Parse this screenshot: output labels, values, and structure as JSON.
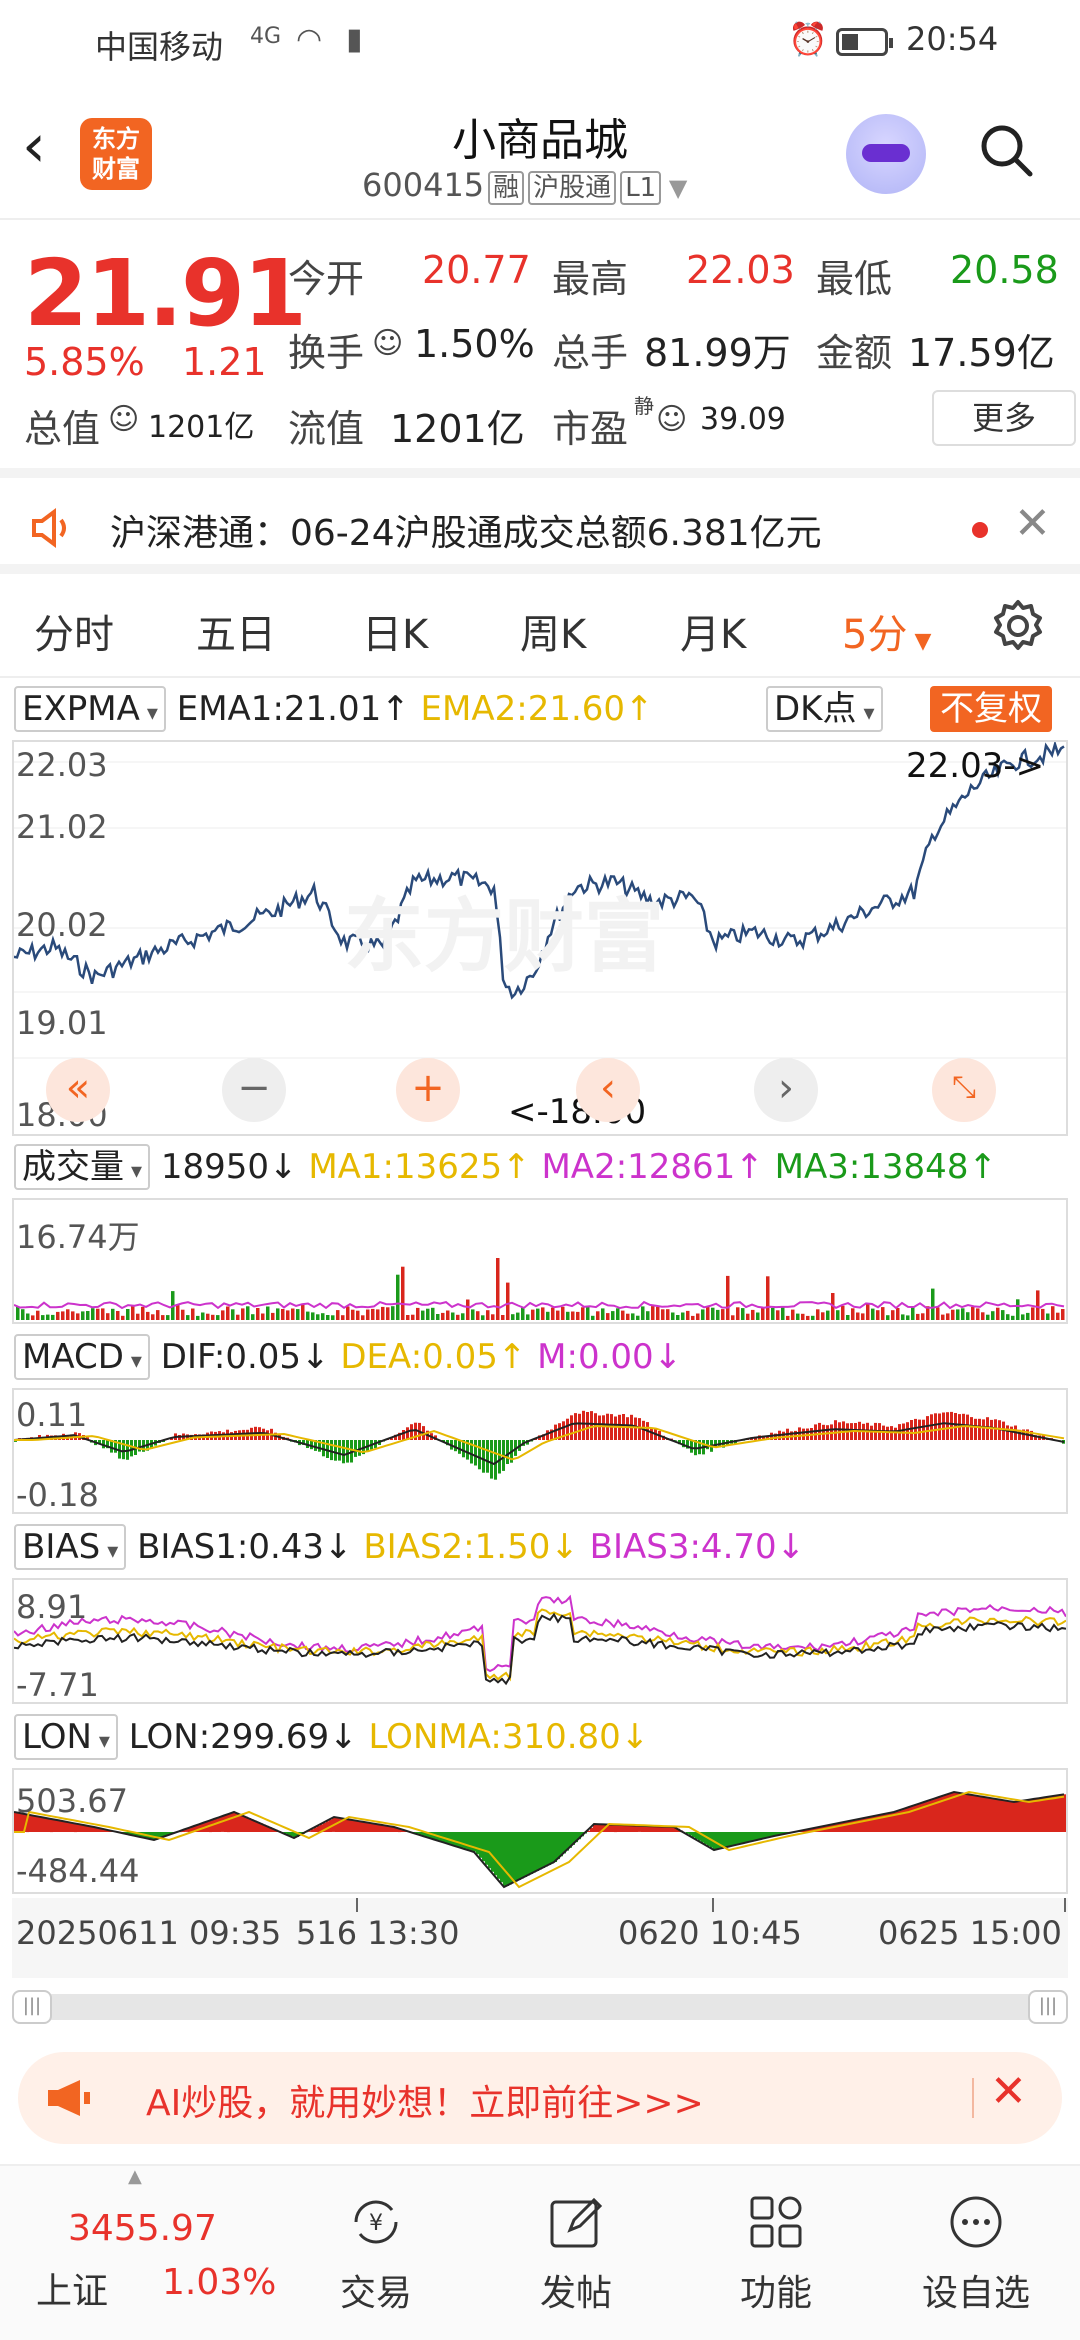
{
  "status_bar": {
    "carrier": "中国移动",
    "network": "4G",
    "time": "20:54"
  },
  "header": {
    "back_icon": "chevron-left-icon",
    "logo_text_1": "东方",
    "logo_text_2": "财富",
    "title": "小商品城",
    "code": "600415",
    "tag_margin": "融",
    "tag_connect": "沪股通",
    "tag_level": "L1"
  },
  "quote": {
    "price": "21.91",
    "change_pct": "5.85%",
    "change": "1.21",
    "open_label": "今开",
    "open": "20.77",
    "high_label": "最高",
    "high": "22.03",
    "low_label": "最低",
    "low": "20.58",
    "turnover_label": "换手",
    "turnover": "1.50%",
    "volume_label": "总手",
    "volume": "81.99万",
    "amount_label": "金额",
    "amount": "17.59亿",
    "mktcap_label": "总值",
    "mktcap": "1201亿",
    "float_label": "流值",
    "float": "1201亿",
    "pe_label": "市盈",
    "pe_sup": "静",
    "pe": "39.09",
    "more_button": "更多"
  },
  "notice": {
    "text": "沪深港通：06-24沪股通成交总额6.381亿元"
  },
  "tabs": [
    {
      "label": "分时"
    },
    {
      "label": "五日"
    },
    {
      "label": "日K"
    },
    {
      "label": "周K"
    },
    {
      "label": "月K"
    },
    {
      "label": "5分"
    }
  ],
  "main_chart": {
    "indicator": "EXPMA",
    "ema1": "EMA1:21.01↑",
    "ema2": "EMA2:21.60↑",
    "dk_button": "DK点",
    "fuquan_button": "不复权",
    "y_ticks": [
      "22.03",
      "21.02",
      "20.02",
      "19.01",
      "18.00"
    ],
    "max_label": "22.03->",
    "min_label": "<-18.00",
    "watermark": "东方财富"
  },
  "volume_panel": {
    "indicator": "成交量",
    "value": "18950↓",
    "ma1": "MA1:13625↑",
    "ma2": "MA2:12861↑",
    "ma3": "MA3:13848↑",
    "y_top": "16.74万"
  },
  "macd_panel": {
    "indicator": "MACD",
    "dif": "DIF:0.05↓",
    "dea": "DEA:0.05↑",
    "m": "M:0.00↓",
    "y_top": "0.11",
    "y_bottom": "-0.18"
  },
  "bias_panel": {
    "indicator": "BIAS",
    "bias1": "BIAS1:0.43↓",
    "bias2": "BIAS2:1.50↓",
    "bias3": "BIAS3:4.70↓",
    "y_top": "8.91",
    "y_bottom": "-7.71"
  },
  "lon_panel": {
    "indicator": "LON",
    "lon": "LON:299.69↓",
    "lonma": "LONMA:310.80↓",
    "y_top": "503.67",
    "y_bottom": "-484.44"
  },
  "x_axis": {
    "left": "20250611 09:35",
    "mid_fragment": "516 13:30",
    "mid2": "0620 10:45",
    "right": "0625 15:00"
  },
  "ad": {
    "text": "AI炒股，就用妙想！立即前往>>>"
  },
  "bottom_nav": {
    "index_value": "3455.97",
    "index_name": "上证",
    "index_change": "1.03%",
    "items": [
      {
        "label": "交易"
      },
      {
        "label": "发帖"
      },
      {
        "label": "功能"
      },
      {
        "label": "设自选"
      }
    ]
  },
  "colors": {
    "up": "#e8322b",
    "down": "#1a9a1a",
    "accent": "#f26522",
    "line": "#2a4a7a",
    "ema2": "#e6b800",
    "ma2": "#cc33cc"
  }
}
